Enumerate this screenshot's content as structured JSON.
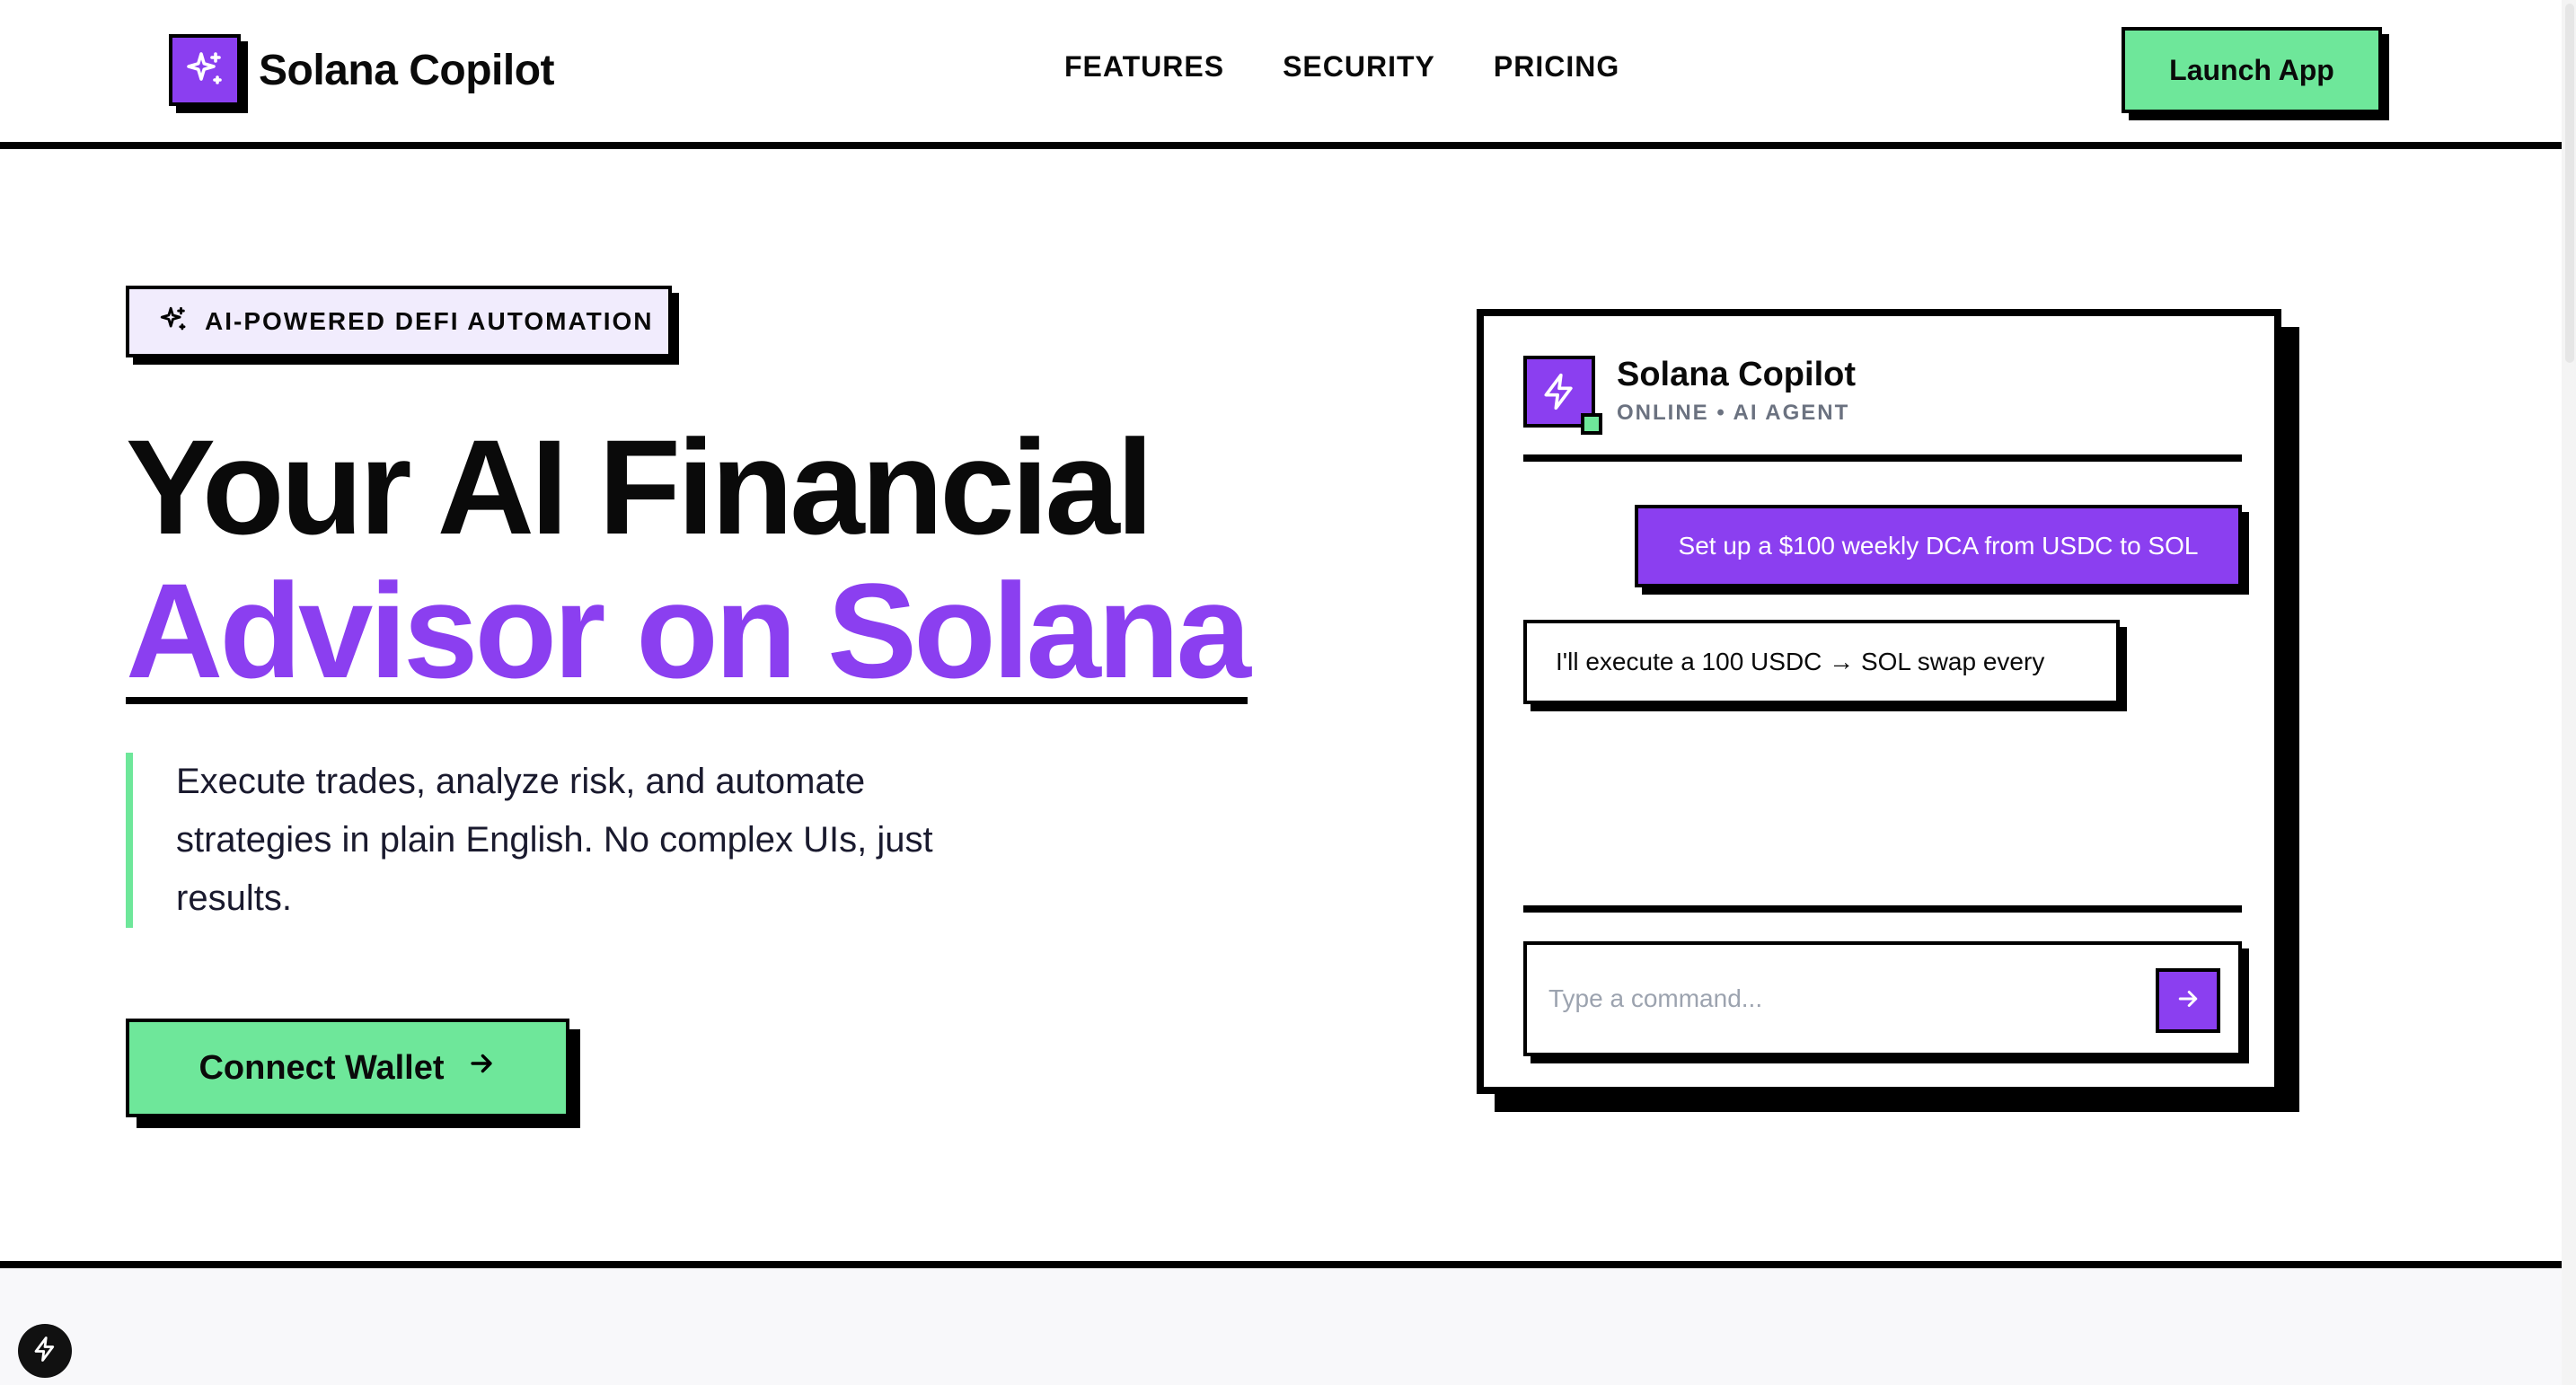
{
  "brand": {
    "name": "Solana Copilot",
    "logo_icon": "sparkles-icon",
    "accent_color": "#8b3ff0",
    "success_color": "#6ee79a"
  },
  "nav": {
    "links": [
      {
        "label": "FEATURES"
      },
      {
        "label": "SECURITY"
      },
      {
        "label": "PRICING"
      }
    ],
    "cta_label": "Launch App"
  },
  "hero": {
    "badge_icon": "sparkles-icon",
    "badge_text": "AI-POWERED DEFI AUTOMATION",
    "title_line1": "Your AI Financial",
    "title_line2": "Advisor on Solana",
    "description": "Execute trades, analyze risk, and automate strategies in plain English. No complex UIs, just results.",
    "cta_label": "Connect Wallet",
    "cta_icon": "arrow-right-icon"
  },
  "chat": {
    "agent_name": "Solana Copilot",
    "agent_status": "ONLINE • AI AGENT",
    "agent_icon": "lightning-icon",
    "messages": [
      {
        "role": "user",
        "text": "Set up a $100 weekly DCA from USDC to SOL"
      },
      {
        "role": "bot",
        "text": "I'll execute a 100 USDC → SOL swap every"
      }
    ],
    "input_placeholder": "Type a command...",
    "send_icon": "arrow-right-icon"
  },
  "dev_badge": {
    "icon": "lightning-icon"
  }
}
